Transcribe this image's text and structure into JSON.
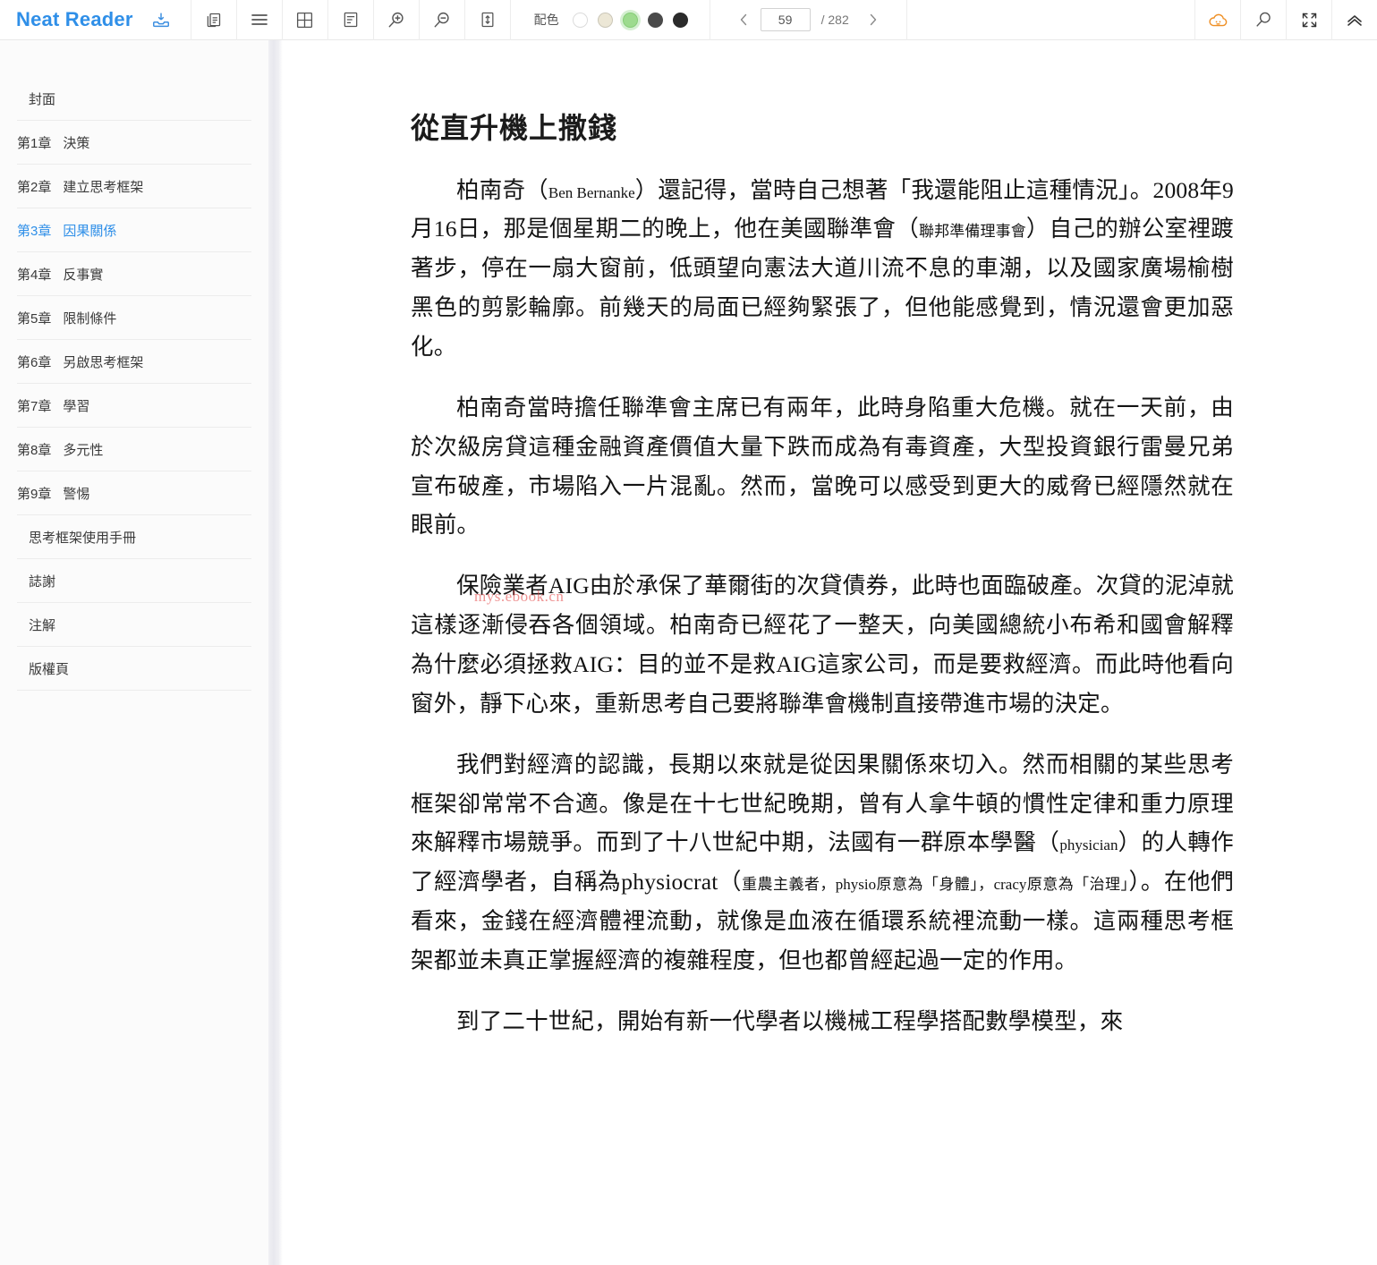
{
  "app": {
    "brand": "Neat Reader",
    "brand_color": "#2f8fe8"
  },
  "toolbar": {
    "icons": [
      {
        "name": "save-to-library-icon",
        "label": "儲存"
      },
      {
        "name": "copy-icon",
        "label": "複製"
      },
      {
        "name": "toc-list-icon",
        "label": "目錄"
      },
      {
        "name": "grid-layout-icon",
        "label": "版面"
      },
      {
        "name": "notes-icon",
        "label": "筆記"
      },
      {
        "name": "zoom-in-icon",
        "label": "放大"
      },
      {
        "name": "zoom-out-icon",
        "label": "縮小"
      },
      {
        "name": "line-height-icon",
        "label": "行距"
      }
    ],
    "colors": {
      "label": "配色",
      "swatches": [
        {
          "name": "theme-white",
          "hex": "#ffffff",
          "selected": false
        },
        {
          "name": "theme-sepia",
          "hex": "#ece7d6",
          "selected": false
        },
        {
          "name": "theme-green",
          "hex": "#9ddb8e",
          "selected": true
        },
        {
          "name": "theme-gray",
          "hex": "#4a4a4a",
          "selected": false
        },
        {
          "name": "theme-black",
          "hex": "#2b2b2b",
          "selected": false
        }
      ]
    },
    "pager": {
      "prev": "‹",
      "current": "59",
      "separator": "/ 282",
      "next": "›"
    },
    "right_icons": [
      {
        "name": "cloud-sync-icon",
        "color": "#ef9026"
      },
      {
        "name": "search-icon",
        "color": "#555555"
      },
      {
        "name": "fullscreen-icon",
        "color": "#333333"
      },
      {
        "name": "collapse-toolbar-icon",
        "color": "#333333"
      }
    ]
  },
  "sidebar": {
    "items": [
      {
        "num": "",
        "label": "封面",
        "active": false
      },
      {
        "num": "第1章",
        "label": "決策",
        "active": false
      },
      {
        "num": "第2章",
        "label": "建立思考框架",
        "active": false
      },
      {
        "num": "第3章",
        "label": "因果關係",
        "active": true
      },
      {
        "num": "第4章",
        "label": "反事實",
        "active": false
      },
      {
        "num": "第5章",
        "label": "限制條件",
        "active": false
      },
      {
        "num": "第6章",
        "label": "另啟思考框架",
        "active": false
      },
      {
        "num": "第7章",
        "label": "學習",
        "active": false
      },
      {
        "num": "第8章",
        "label": "多元性",
        "active": false
      },
      {
        "num": "第9章",
        "label": "警惕",
        "active": false
      },
      {
        "num": "",
        "label": "思考框架使用手冊",
        "active": false
      },
      {
        "num": "",
        "label": "誌謝",
        "active": false
      },
      {
        "num": "",
        "label": "注解",
        "active": false
      },
      {
        "num": "",
        "label": "版權頁",
        "active": false
      }
    ]
  },
  "content": {
    "title": "從直升機上撒錢",
    "watermark": "mys.ebook.cn",
    "paragraphs": [
      {
        "id": "p1",
        "parts": [
          {
            "t": "柏南奇（",
            "s": "n"
          },
          {
            "t": "Ben Bernanke",
            "s": "a"
          },
          {
            "t": "）還記得，當時自己想著「我還能阻止這種情況」。2008年9月16日，那是個星期二的晚上，他在美國聯準會（",
            "s": "n"
          },
          {
            "t": "聯邦準備理事會",
            "s": "a"
          },
          {
            "t": "）自己的辦公室裡踱著步，停在一扇大窗前，低頭望向憲法大道川流不息的車潮，以及國家廣場榆樹黑色的剪影輪廓。前幾天的局面已經夠緊張了，但他能感覺到，情況還會更加惡化。",
            "s": "n"
          }
        ]
      },
      {
        "id": "p2",
        "parts": [
          {
            "t": "柏南奇當時擔任聯準會主席已有兩年，此時身陷重大危機。就在一天前，由於次級房貸這種金融資產價值大量下跌而成為有毒資產，大型投資銀行雷曼兄弟宣布破產，市場陷入一片混亂。然而，當晚可以感受到更大的威脅已經隱然就在眼前。",
            "s": "n"
          }
        ]
      },
      {
        "id": "p3",
        "parts": [
          {
            "t": "保險業者AIG由於承保了華爾街的次貸債券，此時也面臨破產。次貸的泥淖就這樣逐漸侵吞各個領域。柏南奇已經花了一整天，向美國總統小布希和國會解釋為什麼必須拯救AIG：目的並不是救AIG這家公司，而是要救經濟。而此時他看向窗外，靜下心來，重新思考自己要將聯準會機制直接帶進市場的決定。",
            "s": "n"
          }
        ]
      },
      {
        "id": "p4",
        "parts": [
          {
            "t": "我們對經濟的認識，長期以來就是從因果關係來切入。然而相關的某些思考框架卻常常不合適。像是在十七世紀晚期，曾有人拿牛頓的慣性定律和重力原理來解釋市場競爭。而到了十八世紀中期，法國有一群原本學醫（",
            "s": "n"
          },
          {
            "t": "physician",
            "s": "a"
          },
          {
            "t": "）的人轉作了經濟學者，自稱為physiocrat（",
            "s": "n"
          },
          {
            "t": "重農主義者，physio原意為「身體」，cracy原意為「治理」",
            "s": "a"
          },
          {
            "t": "）。在他們看來，金錢在經濟體裡流動，就像是血液在循環系統裡流動一樣。這兩種思考框架都並未真正掌握經濟的複雜程度，但也都曾經起過一定的作用。",
            "s": "n"
          }
        ]
      },
      {
        "id": "p5",
        "parts": [
          {
            "t": "到了二十世紀，開始有新一代學者以機械工程學搭配數學模型，來",
            "s": "n"
          }
        ]
      }
    ]
  }
}
